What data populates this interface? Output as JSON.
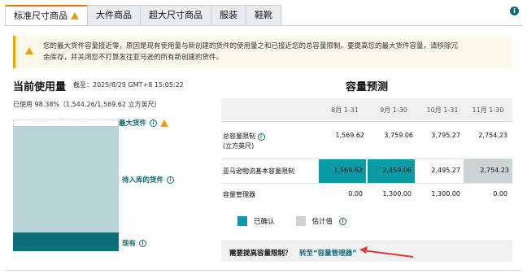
{
  "tabs": [
    {
      "label": "标准尺寸商品",
      "active": true,
      "warning": true
    },
    {
      "label": "大件商品"
    },
    {
      "label": "超大尺寸商品"
    },
    {
      "label": "服装"
    },
    {
      "label": "鞋靴"
    }
  ],
  "alert": {
    "line1": "您的最大货件容量接近零，原因是现有使用量与新创建的货件的使用量之和已接近您的总容量限制。要提高您的最大货件容量，请移除冗",
    "line2": "余库存，并关闭您不打算发往亚马逊的所有新创建的货件。"
  },
  "usage": {
    "title": "当前使用量",
    "timestamp": "截至：2025/8/29 GMT+8 15:05:22",
    "percent_text": "已使用 98.38%（1,544.26/1,569.62 立方英尺）",
    "used_fraction": 0.9838,
    "current_fraction": 0.14,
    "markers": {
      "max": "最大货件",
      "inbound": "待入库的货件",
      "current": "现有"
    }
  },
  "forecast": {
    "title": "容量预测",
    "months": [
      "8月 1-31",
      "9月 1-30",
      "10月 1-31",
      "11月 1-30"
    ],
    "rows": [
      {
        "label1": "总容量限制",
        "label2": "(立方英尺)",
        "info": true,
        "values": [
          "1,569.62",
          "3,759.06",
          "3,795.27",
          "2,754.23"
        ],
        "styles": [
          "",
          "",
          "",
          ""
        ]
      },
      {
        "label1": "亚马逊物流基本容量限制",
        "label2": "",
        "info": false,
        "values": [
          "1,569.62",
          "2,459.06",
          "2,495.27",
          "2,754.23"
        ],
        "styles": [
          "conf",
          "conf",
          "est",
          "est"
        ]
      },
      {
        "label1": "容量管理器",
        "label2": "",
        "info": false,
        "values": [
          "0.00",
          "1,300.00",
          "1,300.00",
          "0.00"
        ],
        "styles": [
          "",
          "",
          "",
          ""
        ]
      }
    ],
    "legend": {
      "confirmed": "已确认",
      "estimated": "估计值"
    },
    "colors": {
      "confirmed": "#0b9ba6",
      "estimated": "#ccd3d6"
    }
  },
  "need": {
    "question": "需要提高容量限制？",
    "link": "转至“容量管理器”"
  },
  "accent": "#e77600",
  "annotation_arrow_color": "#e53935"
}
